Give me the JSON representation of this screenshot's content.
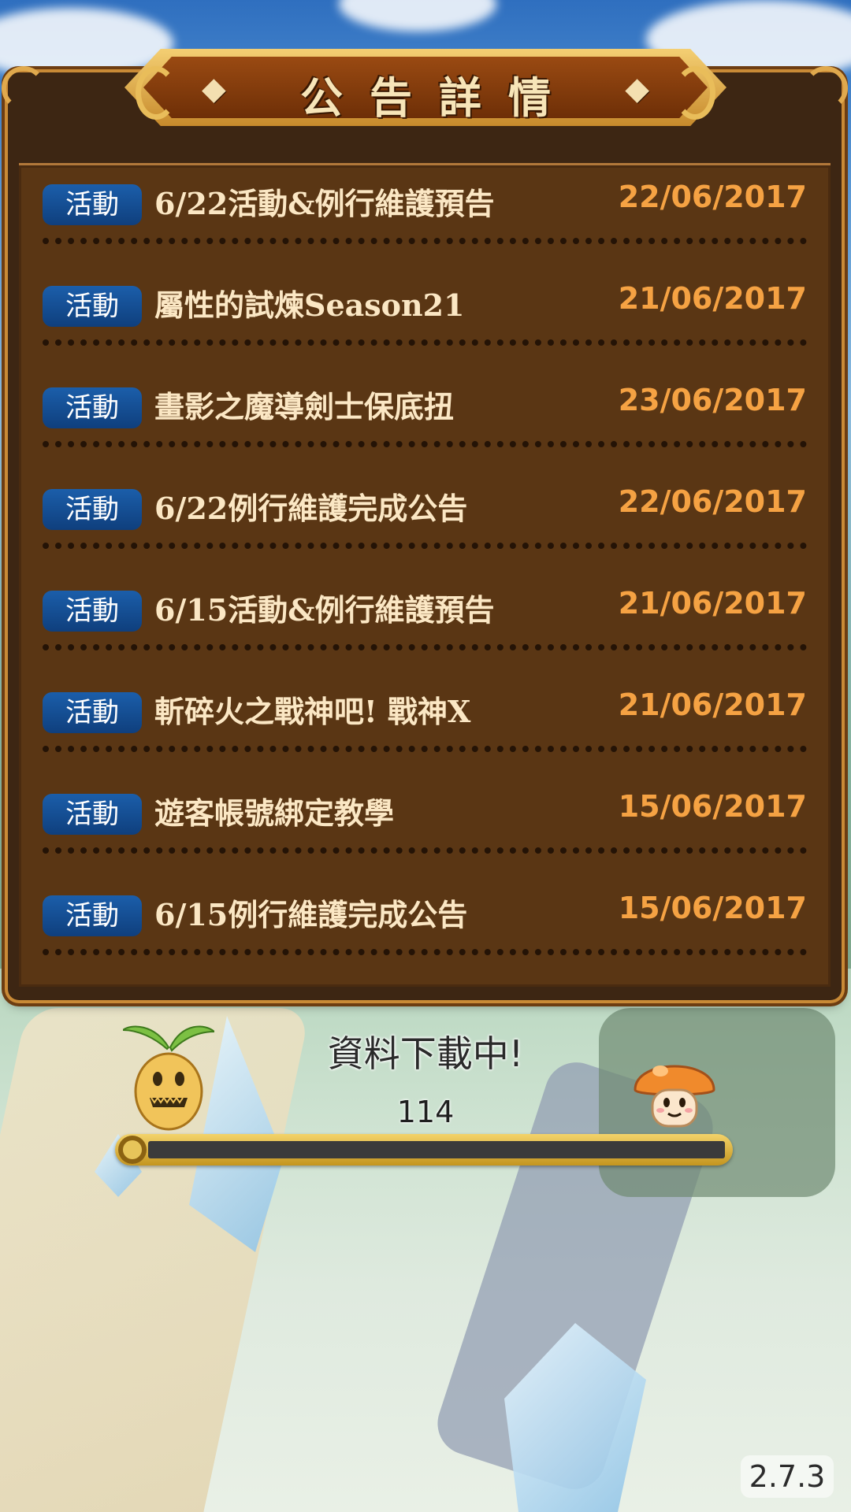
{
  "header": {
    "title": "公告詳情"
  },
  "notices": [
    {
      "tag": "活動",
      "title": "6/22活動&例行維護預告",
      "date": "22/06/2017"
    },
    {
      "tag": "活動",
      "title": "屬性的試煉Season21",
      "date": "21/06/2017"
    },
    {
      "tag": "活動",
      "title": "畫影之魔導劍士保底扭",
      "date": "23/06/2017"
    },
    {
      "tag": "活動",
      "title": "6/22例行維護完成公告",
      "date": "22/06/2017"
    },
    {
      "tag": "活動",
      "title": "6/15活動&例行維護預告",
      "date": "21/06/2017"
    },
    {
      "tag": "活動",
      "title": "斬碎火之戰神吧! 戰神X",
      "date": "21/06/2017"
    },
    {
      "tag": "活動",
      "title": "遊客帳號綁定教學",
      "date": "15/06/2017"
    },
    {
      "tag": "活動",
      "title": "6/15例行維護完成公告",
      "date": "15/06/2017"
    }
  ],
  "loading": {
    "text": "資料下載中!",
    "count": "114",
    "progress": 0.0
  },
  "version": "2.7.3",
  "colors": {
    "panel": "#5a3614",
    "badge": "#1b5eaa",
    "date": "#f5a243",
    "title_text": "#fbe7c4"
  },
  "icons": {
    "left_character": "mandrake-sprite",
    "right_character": "mushroom-sprite"
  }
}
